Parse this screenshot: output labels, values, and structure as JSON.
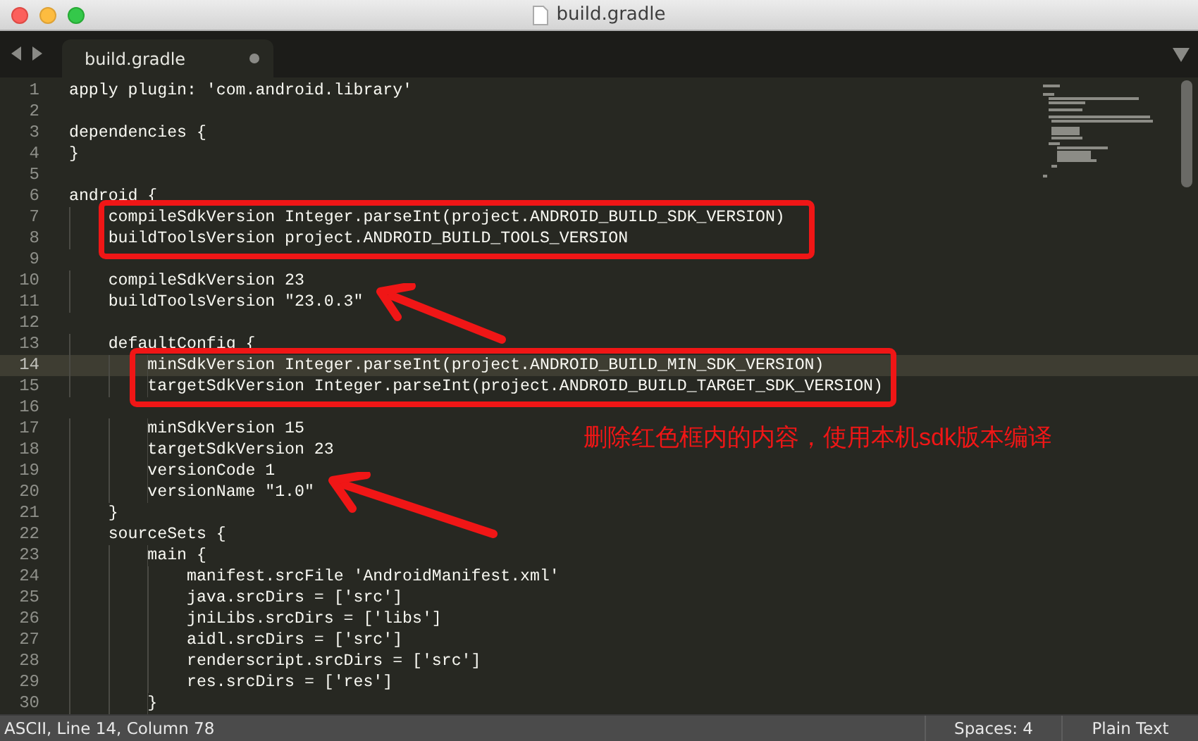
{
  "window": {
    "title": "build.gradle"
  },
  "tabs": [
    {
      "label": "build.gradle",
      "selected": true,
      "modified": true
    }
  ],
  "editor": {
    "lines": [
      {
        "number": "1",
        "text": "apply plugin: 'com.android.library'",
        "selected": false
      },
      {
        "number": "2",
        "selected": false
      },
      {
        "number": "3",
        "text": "dependencies {",
        "selected": false
      },
      {
        "number": "4",
        "text": "}",
        "selected": false
      },
      {
        "number": "5",
        "selected": false
      },
      {
        "number": "6",
        "text": "android {",
        "selected": false
      },
      {
        "number": "7",
        "text": "    compileSdkVersion Integer.parseInt(project.ANDROID_BUILD_SDK_VERSION)",
        "selected": false
      },
      {
        "number": "8",
        "text": "    buildToolsVersion project.ANDROID_BUILD_TOOLS_VERSION",
        "selected": false
      },
      {
        "number": "9",
        "selected": false
      },
      {
        "number": "10",
        "text": "    compileSdkVersion 23",
        "selected": false
      },
      {
        "number": "11",
        "text": "    buildToolsVersion \"23.0.3\"",
        "selected": false
      },
      {
        "number": "12",
        "selected": false
      },
      {
        "number": "13",
        "text": "    defaultConfig {",
        "selected": false
      },
      {
        "number": "14",
        "text": "        minSdkVersion Integer.parseInt(project.ANDROID_BUILD_MIN_SDK_VERSION)",
        "selected": true
      },
      {
        "number": "15",
        "text": "        targetSdkVersion Integer.parseInt(project.ANDROID_BUILD_TARGET_SDK_VERSION)",
        "selected": false
      },
      {
        "number": "16",
        "selected": false
      },
      {
        "number": "17",
        "text": "        minSdkVersion 15",
        "selected": false
      },
      {
        "number": "18",
        "text": "        targetSdkVersion 23",
        "selected": false
      },
      {
        "number": "19",
        "text": "        versionCode 1",
        "selected": false
      },
      {
        "number": "20",
        "text": "        versionName \"1.0\"",
        "selected": false
      },
      {
        "number": "21",
        "text": "    }",
        "selected": false
      },
      {
        "number": "22",
        "text": "    sourceSets {",
        "selected": false
      },
      {
        "number": "23",
        "text": "        main {",
        "selected": false
      },
      {
        "number": "24",
        "text": "            manifest.srcFile 'AndroidManifest.xml'",
        "selected": false
      },
      {
        "number": "25",
        "text": "            java.srcDirs = ['src']",
        "selected": false
      },
      {
        "number": "26",
        "text": "            jniLibs.srcDirs = ['libs']",
        "selected": false
      },
      {
        "number": "27",
        "text": "            aidl.srcDirs = ['src']",
        "selected": false
      },
      {
        "number": "28",
        "text": "            renderscript.srcDirs = ['src']",
        "selected": false
      },
      {
        "number": "29",
        "text": "            res.srcDirs = ['res']",
        "selected": false
      },
      {
        "number": "30",
        "text": "        }",
        "selected": false
      }
    ]
  },
  "annotation": {
    "note": "删除红色框内的内容，使用本机sdk版本编译"
  },
  "status_bar": {
    "position": "ASCII, Line 14, Column 78",
    "indentation": "Spaces: 4",
    "syntax": "Plain Text"
  }
}
